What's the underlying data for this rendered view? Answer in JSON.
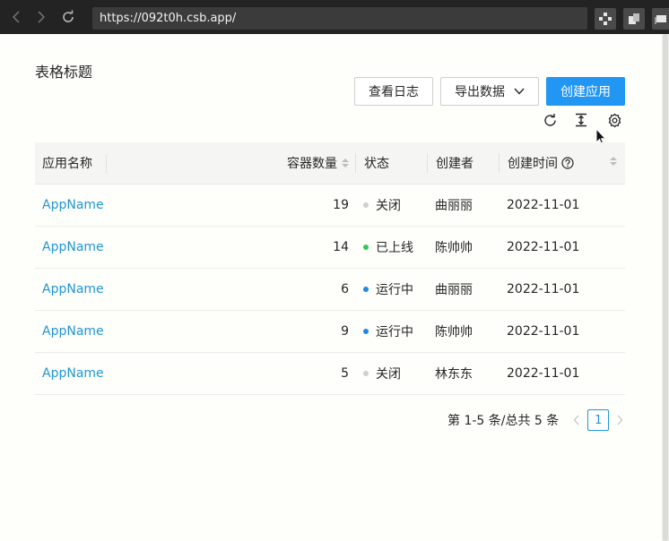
{
  "browser": {
    "url": "https://092t0h.csb.app/",
    "icons": [
      "back-icon",
      "forward-icon",
      "reload-icon",
      "extension-icon",
      "window-icon",
      "tabs-icon"
    ]
  },
  "page": {
    "title": "表格标题"
  },
  "toolbar": {
    "view_log_label": "查看日志",
    "export_label": "导出数据",
    "create_label": "创建应用",
    "accent_color": "#2196f3"
  },
  "table": {
    "columns": {
      "name": "应用名称",
      "count": "容器数量",
      "status": "状态",
      "creator": "创建者",
      "time": "创建时间"
    },
    "rows": [
      {
        "name": "AppName",
        "count": "19",
        "status": "关闭",
        "status_color": "#cfcfcf",
        "creator": "曲丽丽",
        "time": "2022-11-01"
      },
      {
        "name": "AppName",
        "count": "14",
        "status": "已上线",
        "status_color": "#2ecc52",
        "creator": "陈帅帅",
        "time": "2022-11-01"
      },
      {
        "name": "AppName",
        "count": "6",
        "status": "运行中",
        "status_color": "#1e88e5",
        "creator": "曲丽丽",
        "time": "2022-11-01"
      },
      {
        "name": "AppName",
        "count": "9",
        "status": "运行中",
        "status_color": "#1e88e5",
        "creator": "陈帅帅",
        "time": "2022-11-01"
      },
      {
        "name": "AppName",
        "count": "5",
        "status": "关闭",
        "status_color": "#cfcfcf",
        "creator": "林东东",
        "time": "2022-11-01"
      }
    ]
  },
  "pagination": {
    "total_text": "第 1-5 条/总共 5 条",
    "current_page": "1"
  }
}
